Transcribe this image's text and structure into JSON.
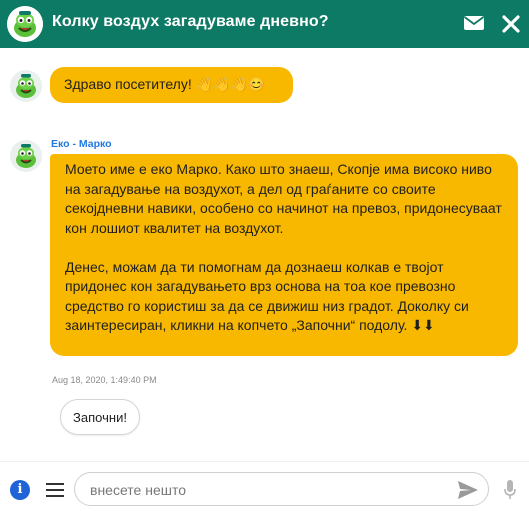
{
  "header": {
    "title": "Колку воздух загадуваме дневно?"
  },
  "colors": {
    "header_bg": "#0d7a65",
    "bubble_bg": "#f9b800",
    "sender_name": "#1f7ae0",
    "info_icon": "#1f63d8"
  },
  "icons": {
    "header_avatar": "robot-avatar-icon",
    "mail": "mail-icon",
    "close": "close-icon",
    "info": "info-icon",
    "menu": "menu-icon",
    "send": "send-icon",
    "mic": "microphone-icon"
  },
  "messages": [
    {
      "text": "Здраво посетителу! 👋👋👋😊"
    },
    {
      "sender": "Еко - Марко",
      "paragraphs": [
        "Моето име е еко Марко. Како што знаеш, Скопје има високо ниво на загадување на воздухот, а дел од граѓаните со своите секојдневни навики, особено со начинот на превоз, придонесуваат кон лошиот квалитет на воздухот.",
        "Денес, можам да ти помогнам да дознаеш колкав е твојот придонес кон загадувањето врз основа на тоа кое превозно средство го користиш за да се движиш низ градот.  Доколку си заинтересиран, кликни на копчето „Започни“ подолу. ⬇⬇"
      ],
      "timestamp": "Aug 18, 2020, 1:49:40 PM"
    }
  ],
  "quick_reply": {
    "label": "Започни!"
  },
  "composer": {
    "placeholder": "внесете нешто",
    "value": ""
  }
}
